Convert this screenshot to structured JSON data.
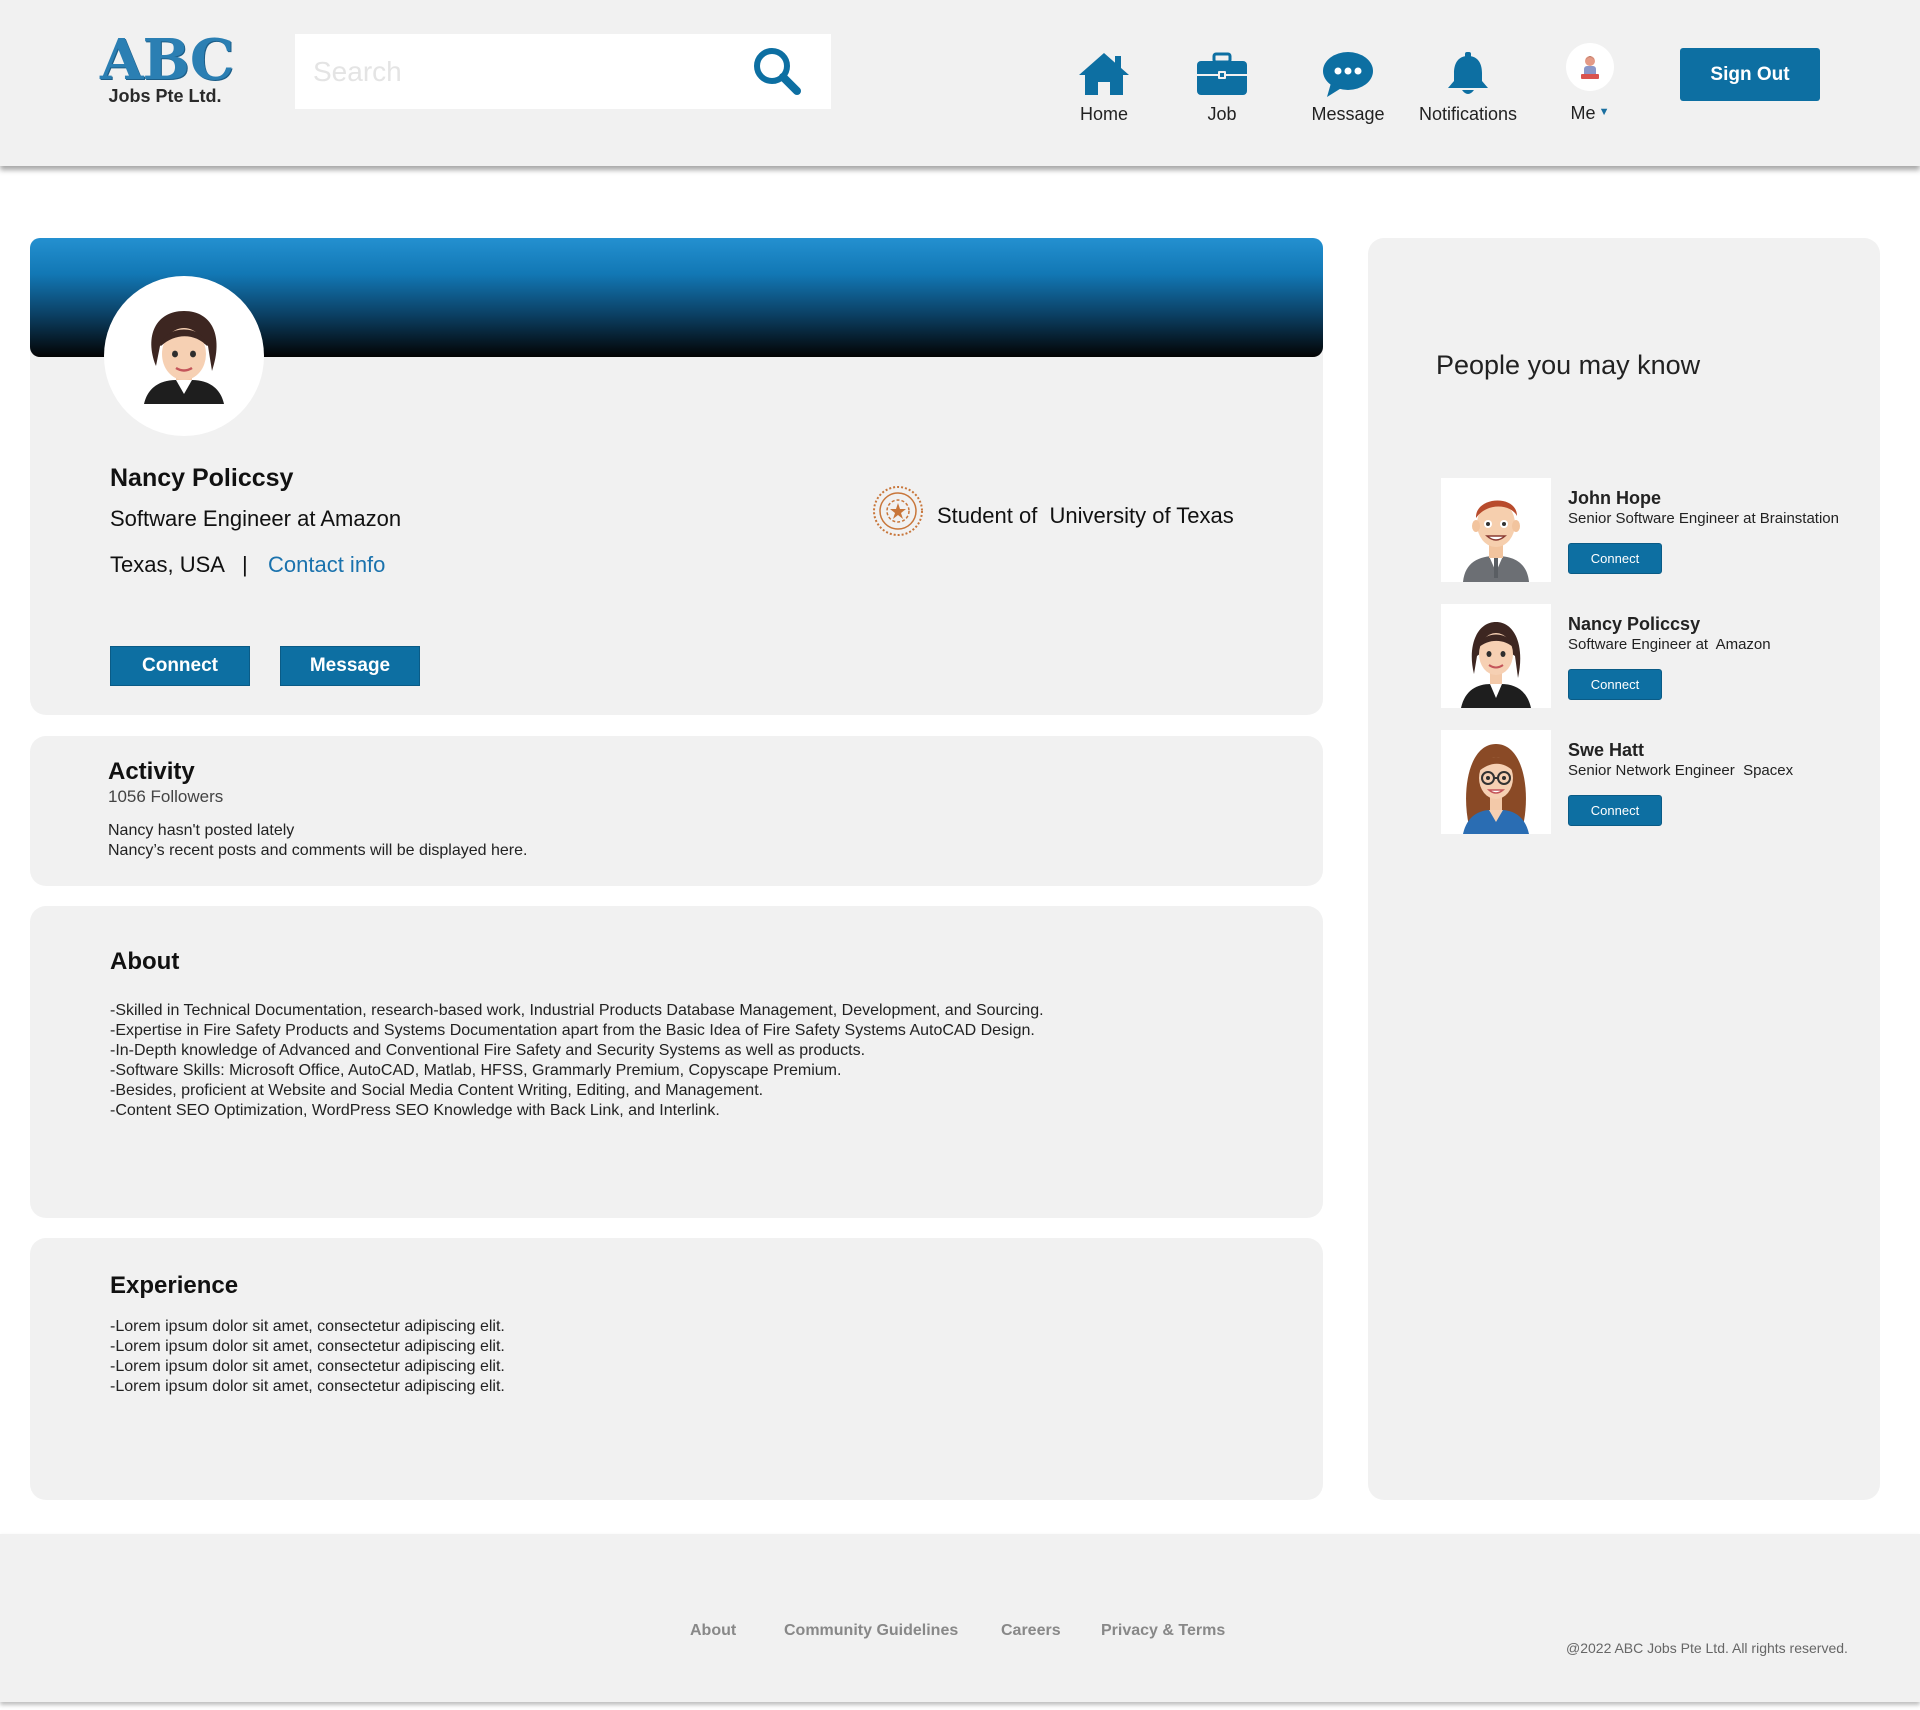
{
  "header": {
    "logo_mark": "ABC",
    "logo_sub": "Jobs Pte Ltd.",
    "search_placeholder": "Search",
    "nav": {
      "home": "Home",
      "job": "Job",
      "message": "Message",
      "notifications": "Notifications",
      "me": "Me"
    },
    "sign_out": "Sign Out"
  },
  "profile": {
    "name": "Nancy Policcsy",
    "title": "Software Engineer at Amazon",
    "location": "Texas, USA",
    "separator": "|",
    "contact_link": "Contact info",
    "education": "Student of  University of Texas",
    "connect_label": "Connect",
    "message_label": "Message"
  },
  "activity": {
    "title": "Activity",
    "followers": "1056 Followers",
    "line1": "Nancy hasn't posted lately",
    "line2": "Nancy’s recent posts and comments will be displayed here."
  },
  "about": {
    "title": "About",
    "lines": [
      "-Skilled in Technical Documentation, research-based work, Industrial Products Database Management, Development, and Sourcing.",
      "-Expertise in Fire Safety Products and Systems Documentation apart from the Basic Idea of Fire Safety Systems AutoCAD Design.",
      "-In-Depth knowledge of Advanced and Conventional Fire Safety and Security Systems as well as products.",
      "-Software Skills: Microsoft Office, AutoCAD, Matlab, HFSS, Grammarly Premium, Copyscape Premium.",
      "-Besides, proficient at Website and Social Media Content Writing, Editing, and Management.",
      "-Content SEO Optimization, WordPress SEO Knowledge with Back Link, and Interlink."
    ]
  },
  "experience": {
    "title": "Experience",
    "lines": [
      "-Lorem ipsum dolor sit amet, consectetur adipiscing elit.",
      "-Lorem ipsum dolor sit amet, consectetur adipiscing elit.",
      "-Lorem ipsum dolor sit amet, consectetur adipiscing elit.",
      "-Lorem ipsum dolor sit amet, consectetur adipiscing elit."
    ]
  },
  "sidebar": {
    "title": "People you may know",
    "people": [
      {
        "name": "John Hope",
        "role": "Senior Software Engineer at Brainstation",
        "button": "Connect"
      },
      {
        "name": "Nancy Policcsy",
        "role": "Software Engineer at  Amazon",
        "button": "Connect"
      },
      {
        "name": "Swe Hatt",
        "role": "Senior Network Engineer  Spacex",
        "button": "Connect"
      }
    ]
  },
  "footer": {
    "links": [
      "About",
      "Community Guidelines",
      "Careers",
      "Privacy & Terms"
    ],
    "copyright": "@2022 ABC Jobs Pte Ltd. All rights reserved."
  },
  "colors": {
    "brand_blue": "#0d6fa2",
    "link_blue": "#1a72ad",
    "panel_gray": "#f1f1f1"
  }
}
